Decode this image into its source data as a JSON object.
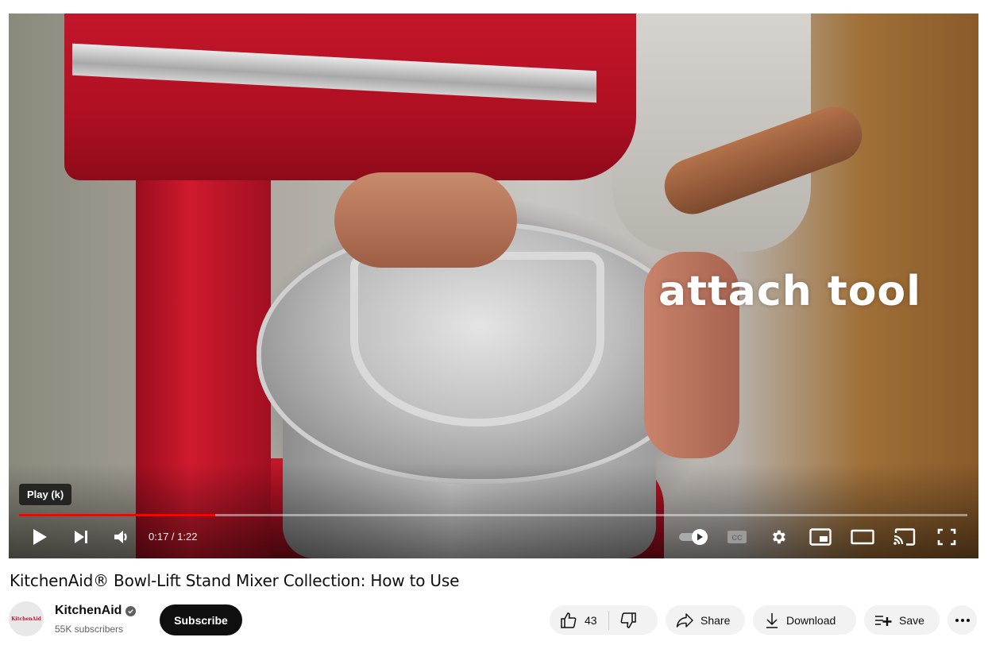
{
  "player": {
    "caption_text": "attach tool",
    "tooltip": "Play (k)",
    "progress_fraction": 0.207,
    "current_time": "0:17",
    "duration": "1:22",
    "time_display": "0:17 / 1:22",
    "progress_color": "#ff0000",
    "controls": {
      "play": "play-icon",
      "next": "next-icon",
      "volume": "volume-icon",
      "autoplay": "autoplay-toggle",
      "captions": "CC",
      "settings": "gear-icon",
      "miniplayer": "miniplayer-icon",
      "theater": "theater-icon",
      "cast": "cast-icon",
      "fullscreen": "fullscreen-icon"
    }
  },
  "video": {
    "title": "KitchenAid® Bowl-Lift Stand Mixer Collection: How to Use"
  },
  "channel": {
    "name": "KitchenAid",
    "avatar_text": "KitchenAid",
    "subscribers": "55K subscribers",
    "verified": true,
    "subscribe_label": "Subscribe"
  },
  "actions": {
    "like_count": "43",
    "share_label": "Share",
    "download_label": "Download",
    "save_label": "Save"
  }
}
